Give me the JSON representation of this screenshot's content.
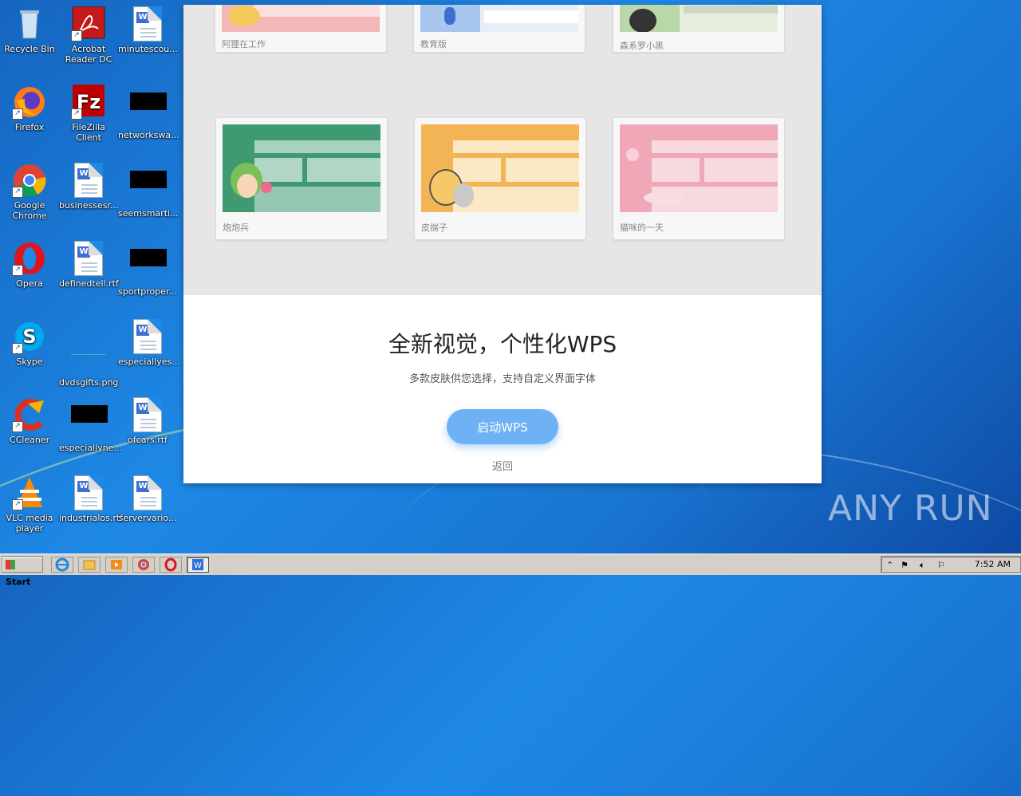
{
  "desktop": {
    "icons": [
      {
        "label": "Recycle Bin"
      },
      {
        "label": "Acrobat Reader DC"
      },
      {
        "label": "minutescou..."
      },
      {
        "label": "Firefox"
      },
      {
        "label": "FileZilla Client"
      },
      {
        "label": "networkswa..."
      },
      {
        "label": "Google Chrome"
      },
      {
        "label": "businessesr..."
      },
      {
        "label": "seemsmarti..."
      },
      {
        "label": "Opera"
      },
      {
        "label": "definedtell.rtf"
      },
      {
        "label": "sportproper..."
      },
      {
        "label": "Skype"
      },
      {
        "label": "dvdsgifts.png"
      },
      {
        "label": "especiallyes..."
      },
      {
        "label": "CCleaner"
      },
      {
        "label": "especiallyne..."
      },
      {
        "label": "ofcars.rtf"
      },
      {
        "label": "VLC media player"
      },
      {
        "label": "industrialos.rtf"
      },
      {
        "label": "servervario..."
      }
    ]
  },
  "wps": {
    "skins": [
      {
        "name": "阿狸在工作",
        "color": "#f2b8b8"
      },
      {
        "name": "教育版",
        "color": "#a9c6ef"
      },
      {
        "name": "森系罗小黑",
        "color": "#b9d7a8"
      },
      {
        "name": "炮炮兵",
        "color": "#3f9a72"
      },
      {
        "name": "皮揣子",
        "color": "#f2b455"
      },
      {
        "name": "猫咪的一天",
        "color": "#f0a8b8"
      }
    ],
    "title": "全新视觉，个性化WPS",
    "subtitle": "多款皮肤供您选择，支持自定义界面字体",
    "launch_label": "启动WPS",
    "back_label": "返回"
  },
  "watermark": "ANY RUN",
  "taskbar": {
    "start_label": "Start",
    "clock": "7:52 AM"
  }
}
